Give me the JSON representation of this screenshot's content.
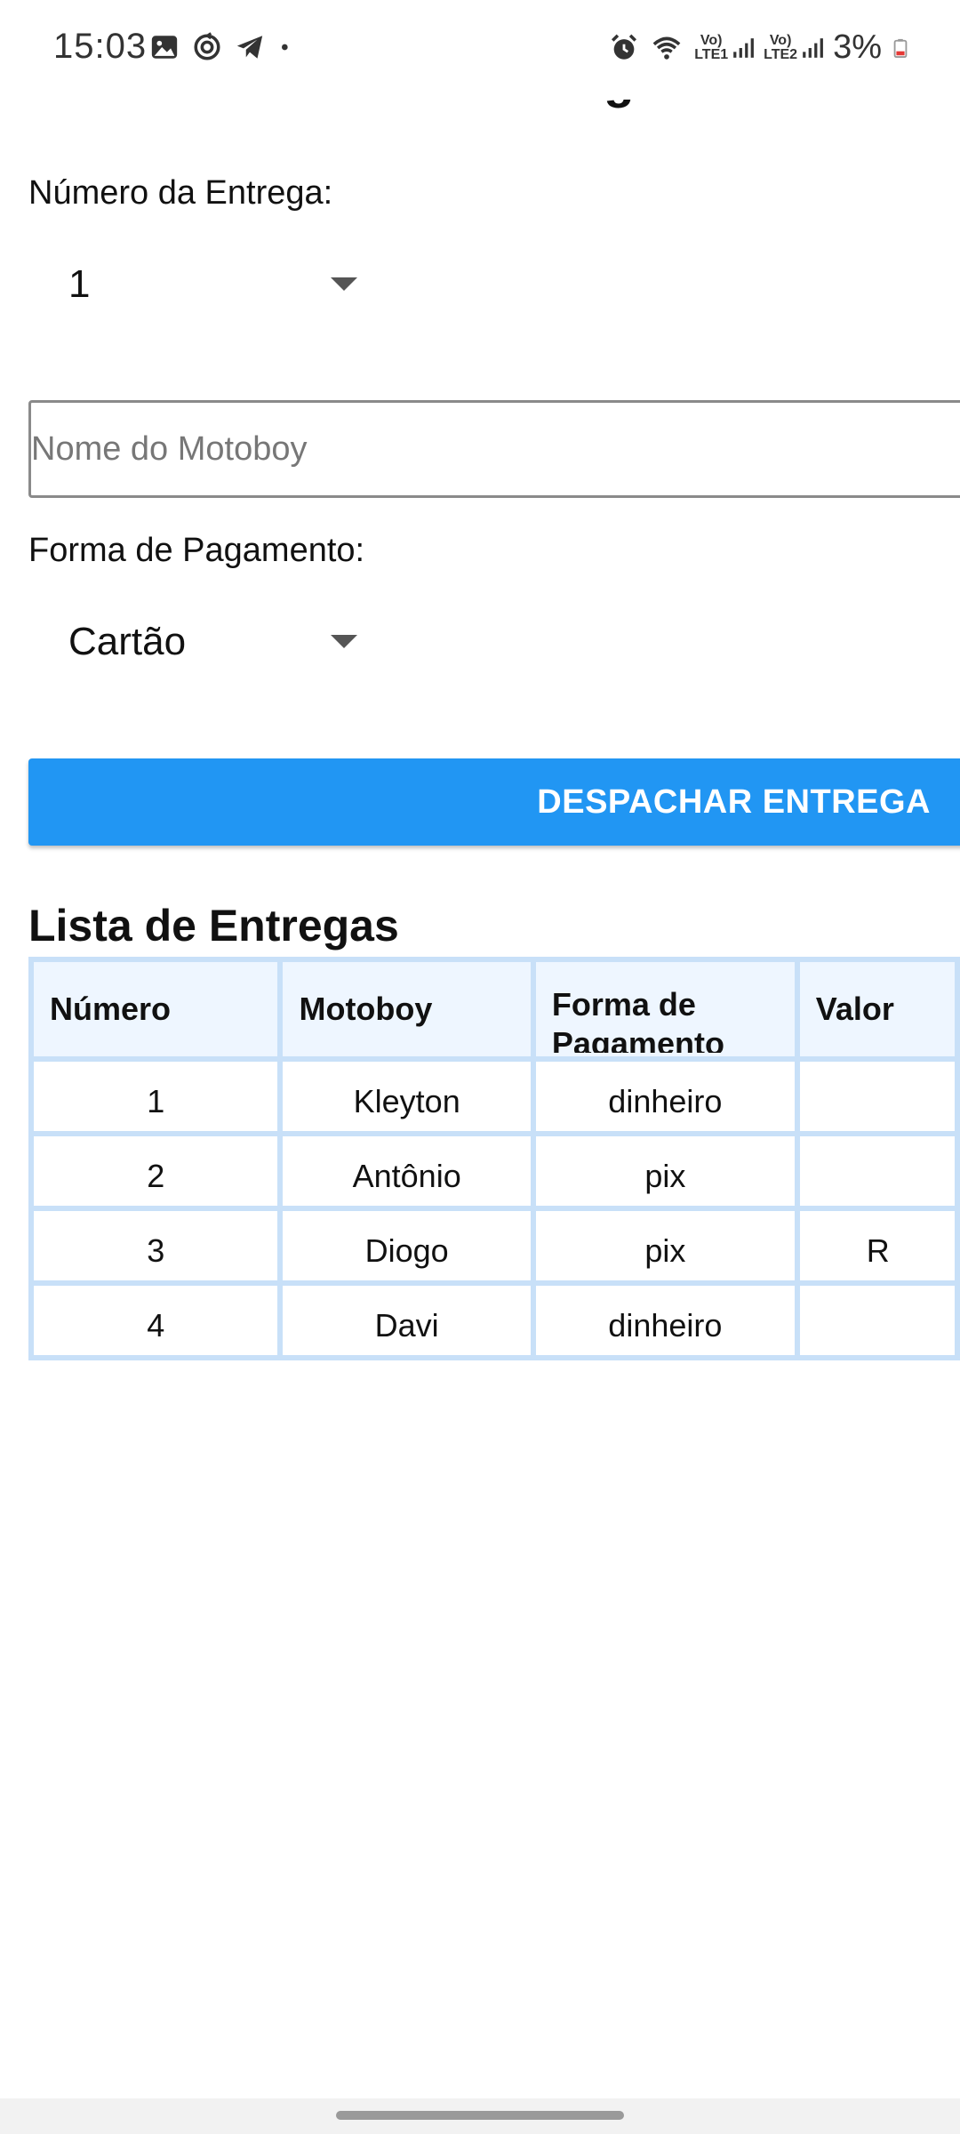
{
  "status_bar": {
    "time": "15:03",
    "battery": "3%",
    "sim1": "LTE1",
    "sim2": "LTE2",
    "left_icons": [
      "gallery-icon",
      "sync-icon",
      "telegram-icon",
      "dot-icon"
    ],
    "right_icons": [
      "alarm-icon",
      "wifi-icon",
      "signal-icon",
      "battery-icon"
    ]
  },
  "page": {
    "title": "Gerenciamento de Entregas"
  },
  "form": {
    "numero_label": "Número da Entrega:",
    "numero_value": "1",
    "motoboy_placeholder": "Nome do Motoboy",
    "pagamento_label": "Forma de Pagamento:",
    "pagamento_value": "Cartão",
    "dispatch_button": "DESPACHAR ENTREGA"
  },
  "list": {
    "title": "Lista de Entregas",
    "columns": [
      "Número",
      "Motoboy",
      "Forma de Pagamento",
      "Valor"
    ],
    "rows": [
      {
        "numero": "1",
        "motoboy": "Kleyton",
        "pagamento": "dinheiro",
        "valor": ""
      },
      {
        "numero": "2",
        "motoboy": "Antônio",
        "pagamento": "pix",
        "valor": ""
      },
      {
        "numero": "3",
        "motoboy": "Diogo",
        "pagamento": "pix",
        "valor": "R"
      },
      {
        "numero": "4",
        "motoboy": "Davi",
        "pagamento": "dinheiro",
        "valor": ""
      }
    ]
  },
  "colors": {
    "accent": "#2196f3",
    "table_border": "#c8e0f8",
    "table_header_bg": "#eef6ff"
  }
}
